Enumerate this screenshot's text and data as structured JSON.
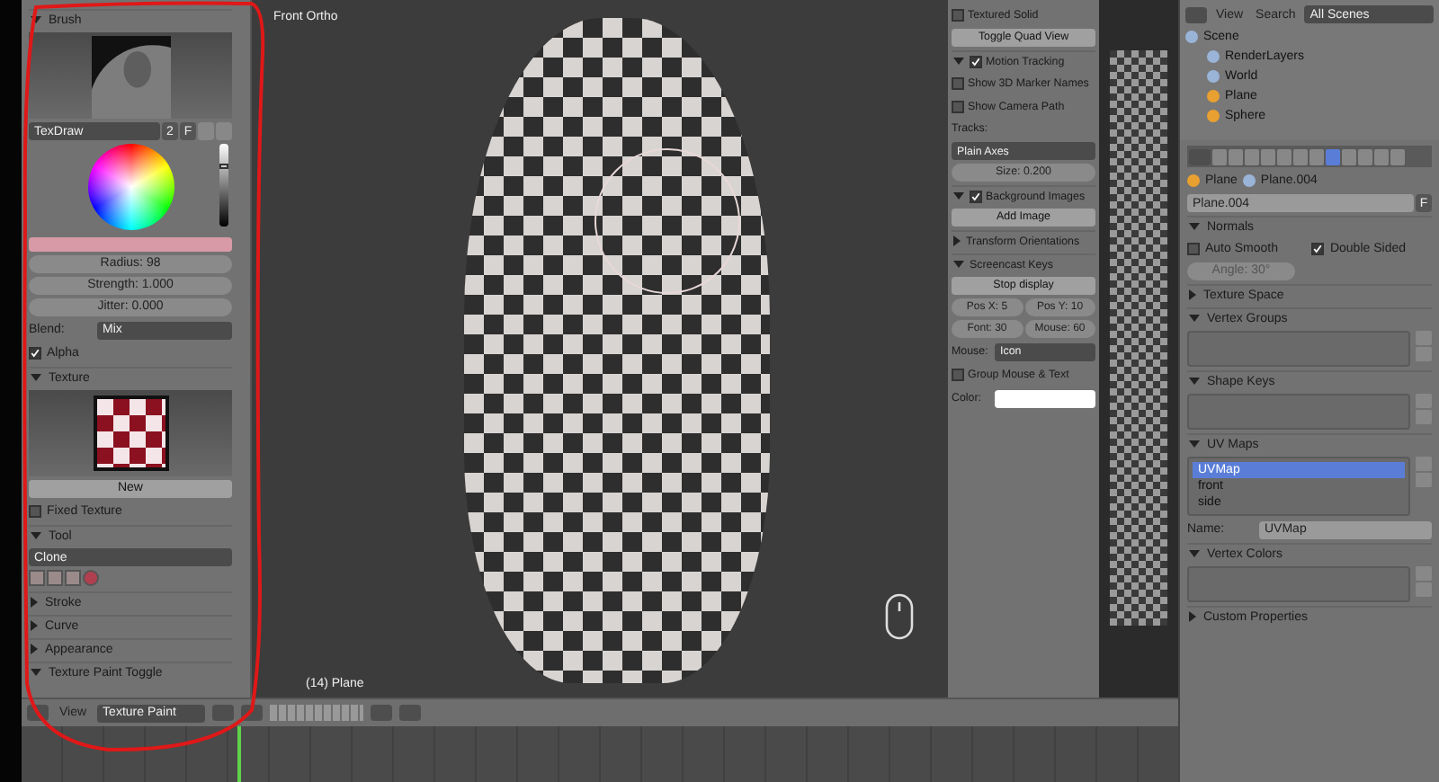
{
  "toolshelf": {
    "brush": {
      "header": "Brush",
      "expanded": true,
      "name": "TexDraw",
      "users": "2",
      "fake_user": "F",
      "value_slider": {
        "level": 0.75
      },
      "radius": "Radius: 98",
      "strength": "Strength: 1.000",
      "jitter": "Jitter: 0.000",
      "blend_label": "Blend:",
      "blend": "Mix",
      "alpha": {
        "label": "Alpha",
        "checked": true
      }
    },
    "texture": {
      "header": "Texture",
      "expanded": true,
      "new_button": "New"
    },
    "fixed_texture": {
      "label": "Fixed Texture",
      "checked": false
    },
    "tool": {
      "header": "Tool",
      "expanded": true,
      "value": "Clone"
    },
    "sections": [
      {
        "label": "Stroke",
        "expanded": false
      },
      {
        "label": "Curve",
        "expanded": false
      },
      {
        "label": "Appearance",
        "expanded": false
      },
      {
        "label": "Texture Paint Toggle",
        "expanded": true
      }
    ]
  },
  "viewport": {
    "title": "Front Ortho",
    "object_label": "(14) Plane"
  },
  "view_properties": [
    {
      "kind": "checkbox",
      "label": "Textured Solid",
      "checked": false
    },
    {
      "kind": "button",
      "label": "Toggle Quad View"
    },
    {
      "kind": "section_checkbox",
      "label": "Motion Tracking",
      "expanded": true,
      "checked": true
    },
    {
      "kind": "checkbox",
      "label": "Show 3D Marker Names",
      "checked": false
    },
    {
      "kind": "checkbox",
      "label": "Show Camera Path",
      "checked": false
    },
    {
      "kind": "label",
      "label": "Tracks:"
    },
    {
      "kind": "dropdown",
      "value": "Plain Axes"
    },
    {
      "kind": "number",
      "value": "Size: 0.200"
    },
    {
      "kind": "section_checkbox",
      "label": "Background Images",
      "expanded": true,
      "checked": true
    },
    {
      "kind": "button",
      "label": "Add Image"
    },
    {
      "kind": "section",
      "label": "Transform Orientations",
      "expanded": false
    },
    {
      "kind": "section",
      "label": "Screencast Keys",
      "expanded": true
    },
    {
      "kind": "button",
      "label": "Stop display"
    },
    {
      "kind": "pair",
      "values": [
        "Pos X: 5",
        "Pos Y: 10"
      ]
    },
    {
      "kind": "pair",
      "values": [
        "Font: 30",
        "Mouse: 60"
      ]
    },
    {
      "kind": "labeled_dropdown",
      "label": "Mouse:",
      "value": "Icon"
    },
    {
      "kind": "checkbox",
      "label": "Group Mouse & Text",
      "checked": false
    },
    {
      "kind": "color",
      "label": "Color:"
    }
  ],
  "header_bar": {
    "view_menu": "View",
    "mode": "Texture Paint"
  },
  "outliner": {
    "view_menu": "View",
    "search_menu": "Search",
    "scenes": "All Scenes",
    "tree": [
      {
        "label": "Scene",
        "children": [
          {
            "label": "RenderLayers"
          },
          {
            "label": "World"
          },
          {
            "label": "Plane"
          },
          {
            "label": "Sphere"
          }
        ]
      }
    ]
  },
  "properties": {
    "tabs": [
      {
        "selected": false
      },
      {
        "selected": false
      },
      {
        "selected": false
      },
      {
        "selected": false
      },
      {
        "selected": false
      },
      {
        "selected": false
      },
      {
        "selected": false
      },
      {
        "selected": true
      },
      {
        "selected": false
      },
      {
        "selected": false
      },
      {
        "selected": false
      },
      {
        "selected": false
      }
    ],
    "breadcrumb": [
      "Plane",
      "Plane.004"
    ],
    "mesh_name": "Plane.004",
    "fake_user": "F",
    "normals": {
      "header": "Normals",
      "expanded": true,
      "auto_smooth": {
        "label": "Auto Smooth",
        "checked": false
      },
      "double_sided": {
        "label": "Double Sided",
        "checked": true
      },
      "angle": "Angle: 30°"
    },
    "texture_space": {
      "header": "Texture Space",
      "expanded": false
    },
    "vertex_groups": {
      "header": "Vertex Groups",
      "expanded": true
    },
    "shape_keys": {
      "header": "Shape Keys",
      "expanded": true
    },
    "uv_maps": {
      "header": "UV Maps",
      "expanded": true,
      "items": [
        {
          "label": "UVMap",
          "selected": true
        },
        {
          "label": "front",
          "selected": false
        },
        {
          "label": "side",
          "selected": false
        }
      ],
      "name_label": "Name:",
      "name_value": "UVMap"
    },
    "vertex_colors": {
      "header": "Vertex Colors",
      "expanded": true
    },
    "custom_properties": {
      "header": "Custom Properties",
      "expanded": false
    }
  }
}
